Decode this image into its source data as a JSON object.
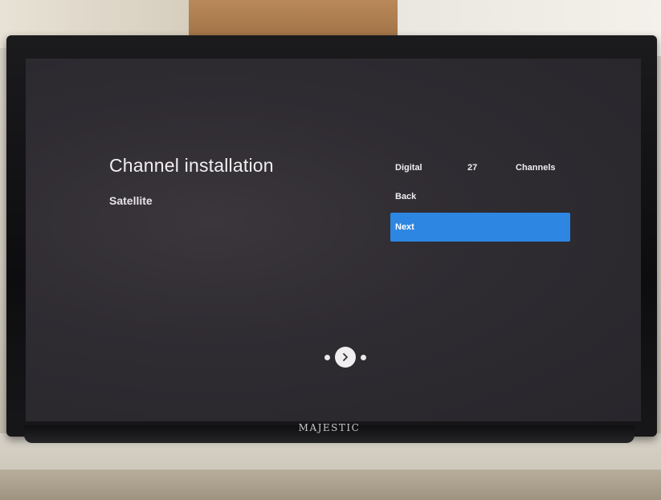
{
  "screen": {
    "title": "Channel installation",
    "subtitle": "Satellite"
  },
  "status": {
    "label": "Digital",
    "count": "27",
    "unit": "Channels"
  },
  "menu": {
    "items": [
      {
        "label": "Back"
      },
      {
        "label": "Next",
        "selected": true
      }
    ]
  },
  "pager": {
    "icon": "chevron-right-icon"
  },
  "device": {
    "brand": "MAJESTIC"
  },
  "colors": {
    "screen_background": "#2f2c32",
    "selection": "#2d86e2",
    "text": "#f1efef"
  }
}
